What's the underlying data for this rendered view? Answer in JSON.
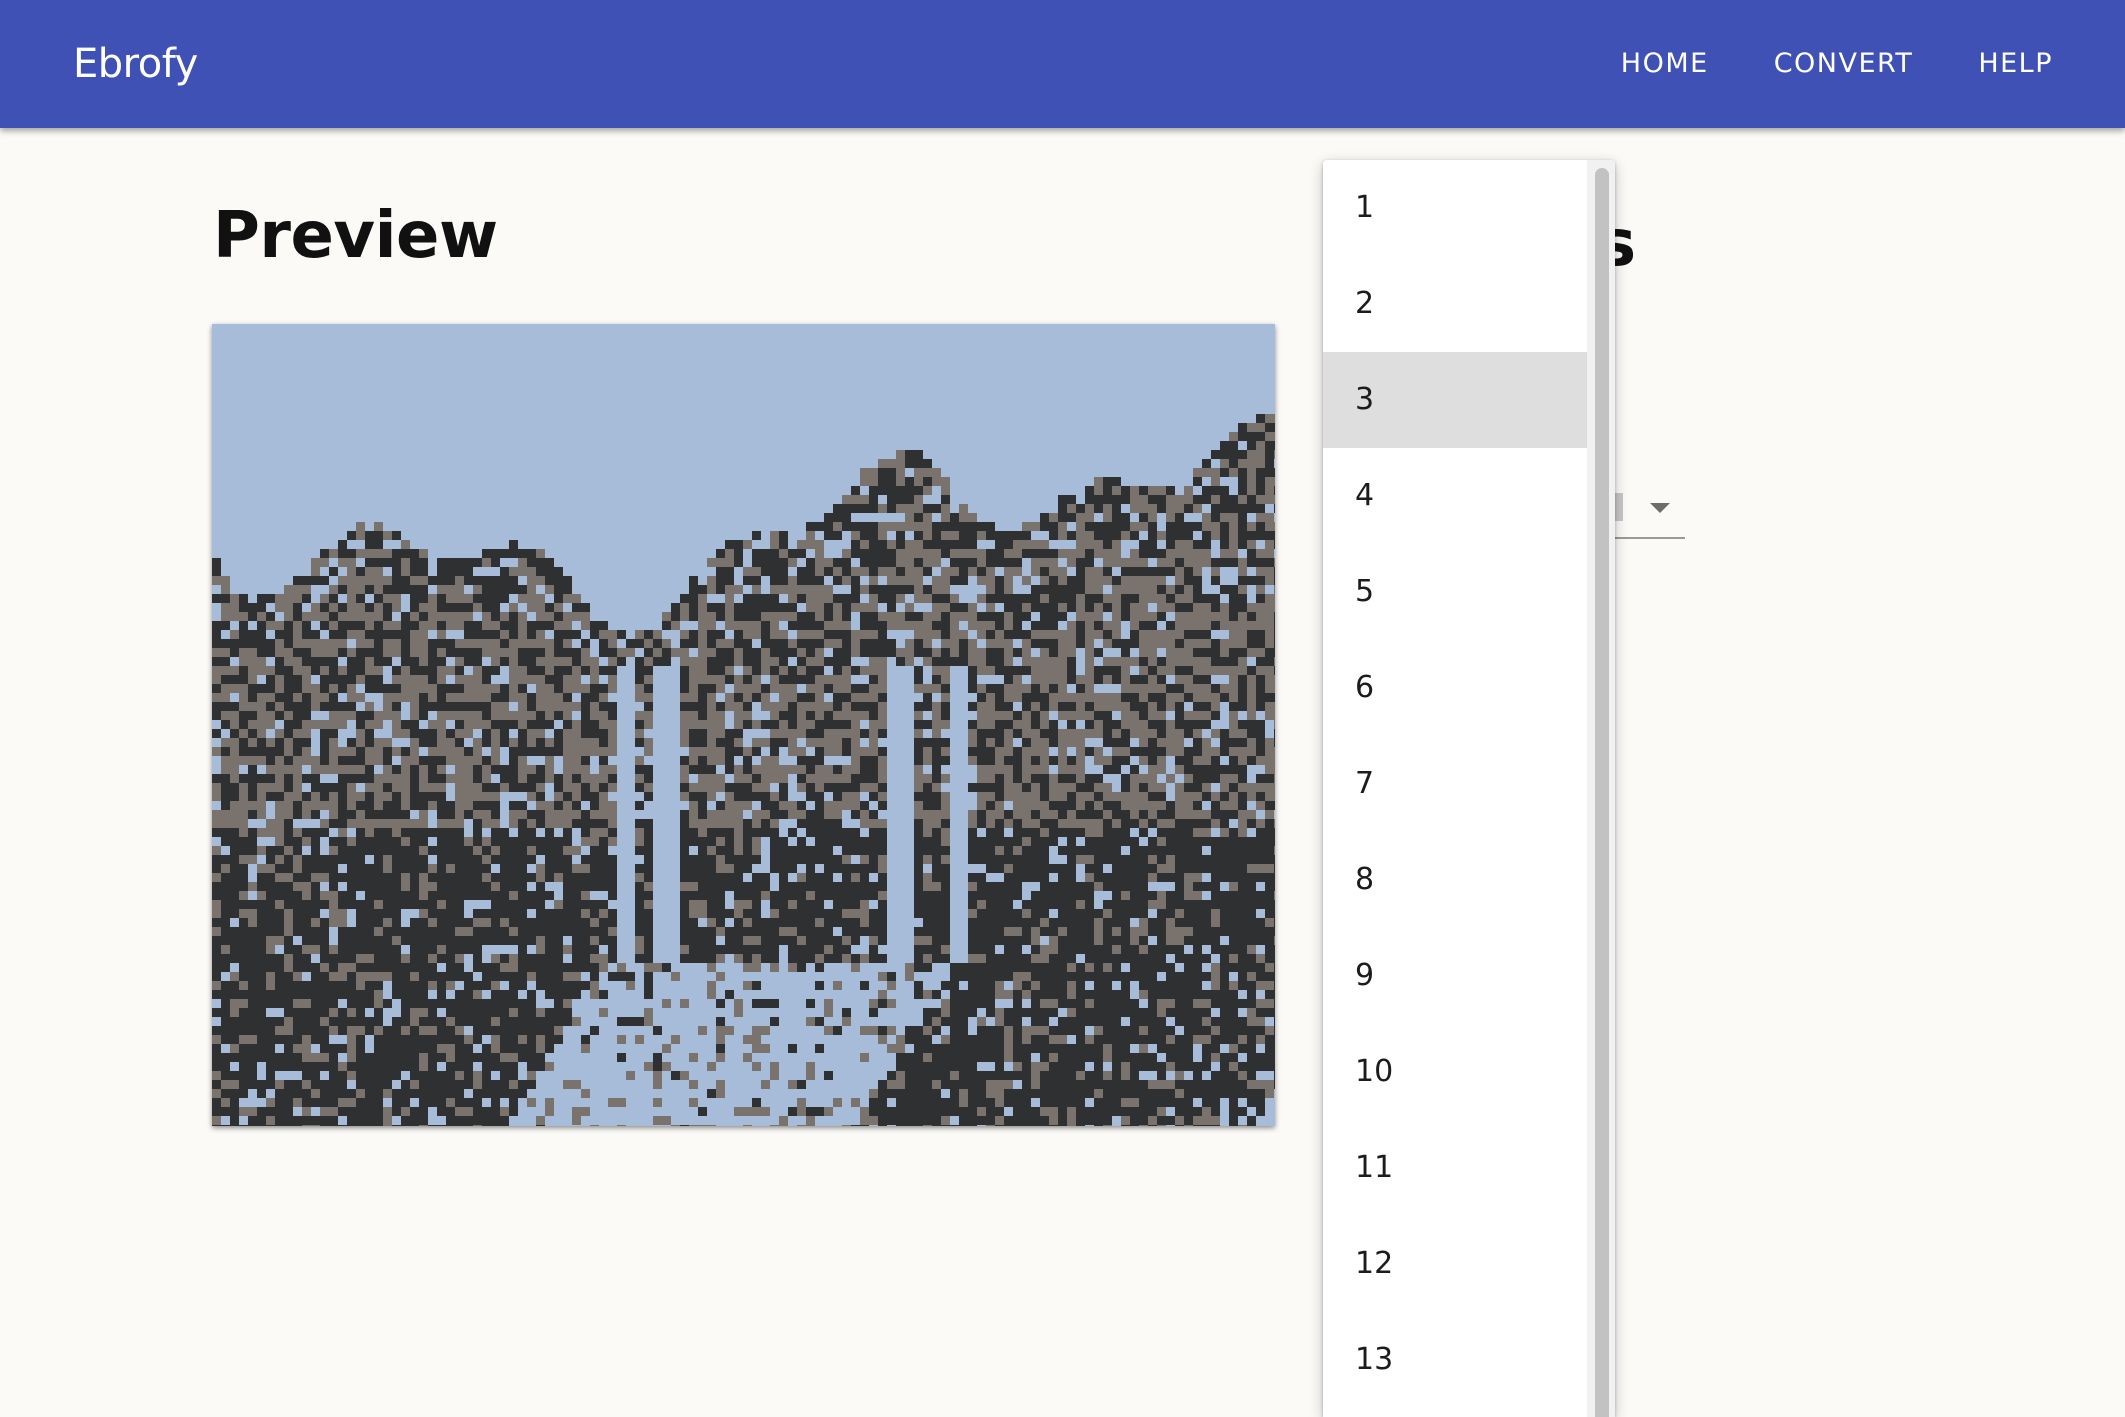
{
  "app": {
    "brand": "Ebrofy",
    "nav": [
      "HOME",
      "CONVERT",
      "HELP"
    ]
  },
  "preview": {
    "title": "Preview",
    "image_palette": [
      "#a6bcd8",
      "#7a726d",
      "#2e3032"
    ]
  },
  "settings": {
    "title_partial": "s"
  },
  "dropdown": {
    "options": [
      "1",
      "2",
      "3",
      "4",
      "5",
      "6",
      "7",
      "8",
      "9",
      "10",
      "11",
      "12",
      "13"
    ],
    "selected": "3"
  },
  "colors": {
    "appbar": "#3f51b5",
    "background": "#fbfaf7",
    "selected_option": "#dedede"
  }
}
